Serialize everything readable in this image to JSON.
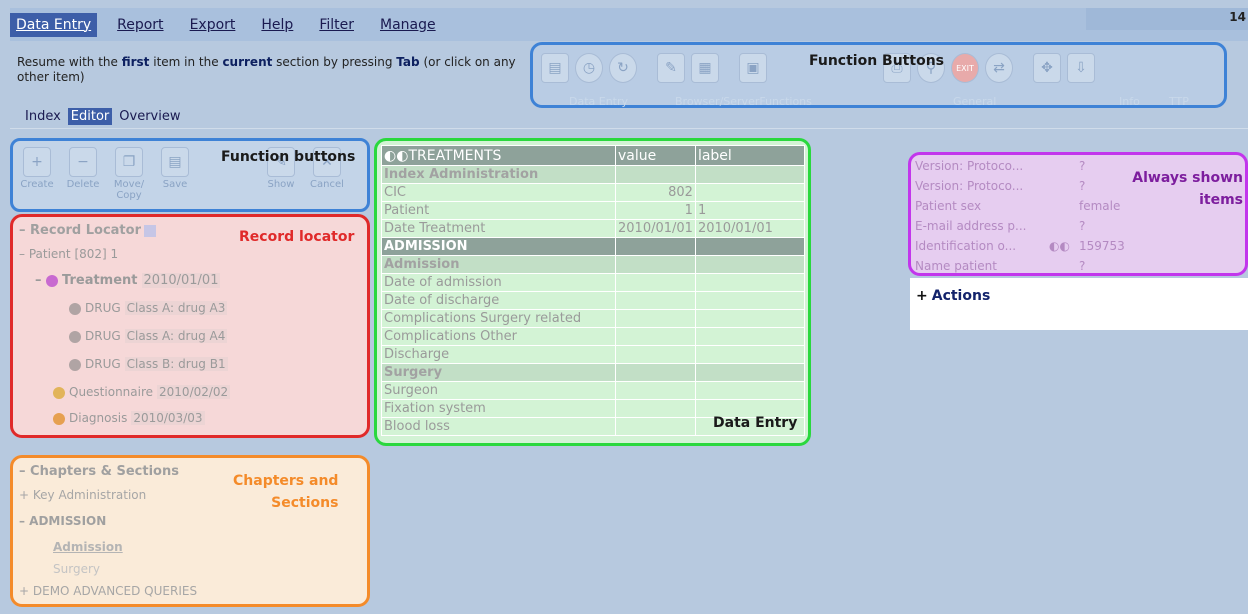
{
  "menu": {
    "items": [
      "Data Entry",
      "Report",
      "Export",
      "Help",
      "Filter",
      "Manage"
    ],
    "active": "Data Entry",
    "corner_number": "14"
  },
  "hint": {
    "p1": "Resume with the ",
    "b1": "first",
    "p2": " item in the ",
    "b2": "current",
    "p3": " section by pressing ",
    "b3": "Tab",
    "p4": " (or click on any other item)"
  },
  "function_buttons_top": {
    "label": "Function Buttons",
    "groups": [
      "Data Entry",
      "Browser/ServerFunctions",
      "General",
      "Info",
      "TTP"
    ]
  },
  "subnav": {
    "items": [
      "Index",
      "Editor",
      "Overview"
    ],
    "active": "Editor"
  },
  "function_buttons_left": {
    "label": "Function buttons",
    "buttons": [
      "Create",
      "Delete",
      "Move/ Copy",
      "Save",
      "Show",
      "Cancel"
    ]
  },
  "record_locator": {
    "title": "Record Locator",
    "label": "Record locator",
    "patient": {
      "name": "Patient",
      "value": "[802] 1"
    },
    "treatment": {
      "name": "Treatment",
      "value": "2010/01/01"
    },
    "drugs": [
      {
        "name": "DRUG",
        "value": "Class A: drug A3"
      },
      {
        "name": "DRUG",
        "value": "Class A: drug A4"
      },
      {
        "name": "DRUG",
        "value": "Class B: drug B1"
      }
    ],
    "questionnaire": {
      "name": "Questionnaire",
      "value": "2010/02/02"
    },
    "diagnosis": {
      "name": "Diagnosis",
      "value": "2010/03/03"
    }
  },
  "chapters": {
    "title": "Chapters & Sections",
    "label_line1": "Chapters and",
    "label_line2": "Sections",
    "items": [
      "+ Key Administration",
      "– ADMISSION",
      "Admission",
      "Surgery",
      "+ DEMO ADVANCED QUERIES"
    ]
  },
  "data_entry": {
    "label": "Data Entry",
    "columns": [
      "TREATMENTS",
      "value",
      "label"
    ],
    "rows": [
      {
        "type": "sub",
        "cells": [
          "Index Administration",
          "",
          ""
        ]
      },
      {
        "type": "row",
        "cells": [
          "CIC",
          "802",
          ""
        ]
      },
      {
        "type": "row",
        "cells": [
          "Patient",
          "1",
          "1"
        ]
      },
      {
        "type": "row",
        "cells": [
          "Date Treatment",
          "2010/01/01",
          "2010/01/01"
        ]
      },
      {
        "type": "sec",
        "cells": [
          "ADMISSION",
          "",
          ""
        ]
      },
      {
        "type": "sub",
        "cells": [
          "Admission",
          "",
          ""
        ]
      },
      {
        "type": "row",
        "cells": [
          "Date of admission",
          "",
          ""
        ]
      },
      {
        "type": "row",
        "cells": [
          "Date of discharge",
          "",
          ""
        ]
      },
      {
        "type": "row",
        "cells": [
          "Complications Surgery related",
          "",
          ""
        ]
      },
      {
        "type": "row",
        "cells": [
          "Complications Other",
          "",
          ""
        ]
      },
      {
        "type": "row",
        "cells": [
          "Discharge",
          "",
          ""
        ]
      },
      {
        "type": "sub",
        "cells": [
          "Surgery",
          "",
          ""
        ]
      },
      {
        "type": "row",
        "cells": [
          "Surgeon",
          "",
          ""
        ]
      },
      {
        "type": "row",
        "cells": [
          "Fixation system",
          "",
          ""
        ]
      },
      {
        "type": "row",
        "cells": [
          "Blood loss",
          "",
          ""
        ]
      }
    ]
  },
  "always_shown": {
    "label_line1": "Always shown",
    "label_line2": "items",
    "rows": [
      {
        "name": "Version: Protoco...",
        "value": "?"
      },
      {
        "name": "Version: Protoco...",
        "value": "?"
      },
      {
        "name": "Patient sex",
        "value": "female"
      },
      {
        "name": "E-mail address p...",
        "value": "?"
      },
      {
        "name": "Identification o...",
        "value": "159753"
      },
      {
        "name": "Name patient",
        "value": "?"
      }
    ]
  },
  "actions": {
    "label": "Actions"
  }
}
